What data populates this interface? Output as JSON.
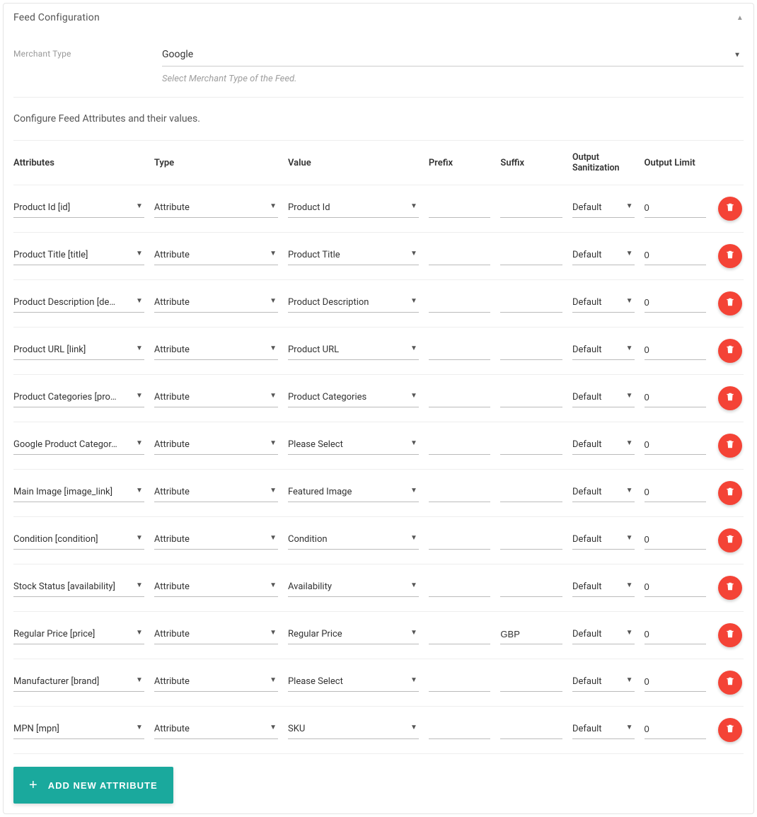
{
  "panel_title": "Feed Configuration",
  "merchant_type_label": "Merchant Type",
  "merchant_type_value": "Google",
  "merchant_type_help": "Select Merchant Type of the Feed.",
  "intro_text": "Configure Feed Attributes and their values.",
  "headers": {
    "attributes": "Attributes",
    "type": "Type",
    "value": "Value",
    "prefix": "Prefix",
    "suffix": "Suffix",
    "sanitization": "Output Sanitization",
    "limit": "Output Limit"
  },
  "rows": [
    {
      "attr": "Product Id [id]",
      "type": "Attribute",
      "value": "Product Id",
      "prefix": "",
      "suffix": "",
      "san": "Default",
      "limit": "0"
    },
    {
      "attr": "Product Title [title]",
      "type": "Attribute",
      "value": "Product Title",
      "prefix": "",
      "suffix": "",
      "san": "Default",
      "limit": "0"
    },
    {
      "attr": "Product Description [de…",
      "type": "Attribute",
      "value": "Product Description",
      "prefix": "",
      "suffix": "",
      "san": "Default",
      "limit": "0"
    },
    {
      "attr": "Product URL [link]",
      "type": "Attribute",
      "value": "Product URL",
      "prefix": "",
      "suffix": "",
      "san": "Default",
      "limit": "0"
    },
    {
      "attr": "Product Categories [pro…",
      "type": "Attribute",
      "value": "Product Categories",
      "prefix": "",
      "suffix": "",
      "san": "Default",
      "limit": "0"
    },
    {
      "attr": "Google Product Categor…",
      "type": "Attribute",
      "value": "Please Select",
      "prefix": "",
      "suffix": "",
      "san": "Default",
      "limit": "0"
    },
    {
      "attr": "Main Image [image_link]",
      "type": "Attribute",
      "value": "Featured Image",
      "prefix": "",
      "suffix": "",
      "san": "Default",
      "limit": "0"
    },
    {
      "attr": "Condition [condition]",
      "type": "Attribute",
      "value": "Condition",
      "prefix": "",
      "suffix": "",
      "san": "Default",
      "limit": "0"
    },
    {
      "attr": "Stock Status [availability]",
      "type": "Attribute",
      "value": "Availability",
      "prefix": "",
      "suffix": "",
      "san": "Default",
      "limit": "0"
    },
    {
      "attr": "Regular Price [price]",
      "type": "Attribute",
      "value": "Regular Price",
      "prefix": "",
      "suffix": "GBP",
      "san": "Default",
      "limit": "0"
    },
    {
      "attr": "Manufacturer [brand]",
      "type": "Attribute",
      "value": "Please Select",
      "prefix": "",
      "suffix": "",
      "san": "Default",
      "limit": "0"
    },
    {
      "attr": "MPN [mpn]",
      "type": "Attribute",
      "value": "SKU",
      "prefix": "",
      "suffix": "",
      "san": "Default",
      "limit": "0"
    }
  ],
  "add_button_label": "ADD NEW ATTRIBUTE"
}
